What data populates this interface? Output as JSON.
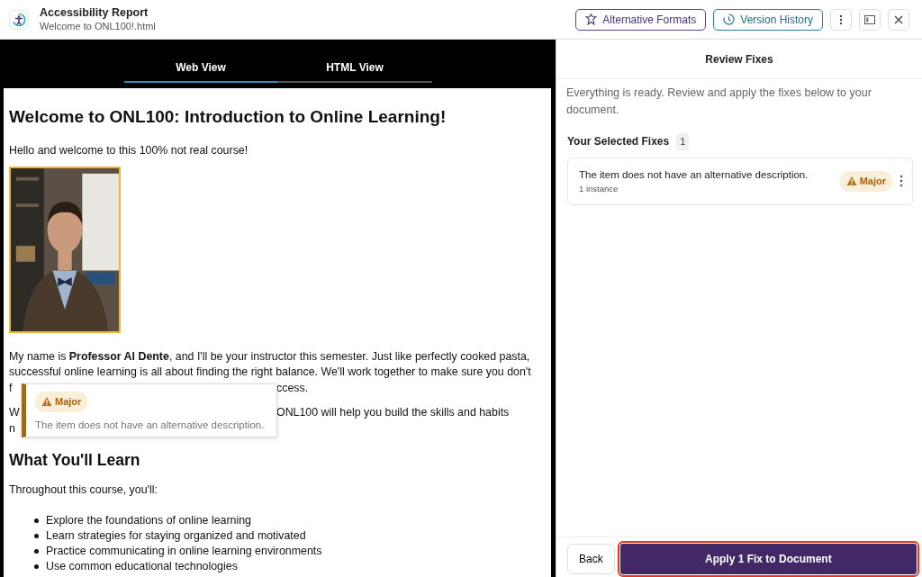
{
  "header": {
    "title": "Accessibility Report",
    "subtitle": "Welcome to ONL100!.html",
    "buttons": [
      {
        "kind": "formats",
        "label": "Alternative Formats"
      },
      {
        "kind": "history",
        "label": "Version History"
      },
      {
        "kind": "more"
      },
      {
        "kind": "panel"
      },
      {
        "kind": "close"
      }
    ]
  },
  "preview": {
    "tabs": [
      {
        "label": "Web View",
        "selected": true
      },
      {
        "label": "HTML View",
        "selected": false
      }
    ],
    "document": {
      "heading": "Welcome to ONL100: Introduction to Online Learning!",
      "intro": "Hello and welcome to this 100% not real course!",
      "image": {
        "kind": "picture"
      },
      "paragraphs": [
        {
          "lines": [
            "My name is **Professor Al Dente**, and I'll be your instructor this semester. Just like perfectly cooked pasta,",
            "successful online learning is all about finding the right balance. We'll work together to make sure you don't"
          ],
          "fragments": [
            {
              "start": "f",
              "end": "ccess."
            }
          ]
        },
        {
          "fragments": [
            {
              "start": "W",
              "end": "ONL100 will help you build the skills and habits"
            },
            {
              "start": "n"
            }
          ]
        }
      ],
      "subheading": "What You'll Learn",
      "list_intro": "Throughout this course, you'll:",
      "list": [
        "Explore the foundations of online learning",
        "Learn strategies for staying organized and motivated",
        "Practice communicating in online learning environments",
        "Use common educational technologies"
      ]
    },
    "popup": {
      "severity": "Major",
      "message": "The item does not have an alternative description."
    }
  },
  "review": {
    "title": "Review Fixes",
    "intro": "Everything is ready. Review and apply the fixes below to your document.",
    "selected_title": "Your Selected Fixes",
    "count": "1",
    "fixes": [
      {
        "message": "The item does not have an alternative description.",
        "instances": "1 instance",
        "severity": "Major"
      }
    ],
    "back": "Back",
    "apply": "Apply 1 Fix to Document",
    "apply_highlighted": true
  }
}
